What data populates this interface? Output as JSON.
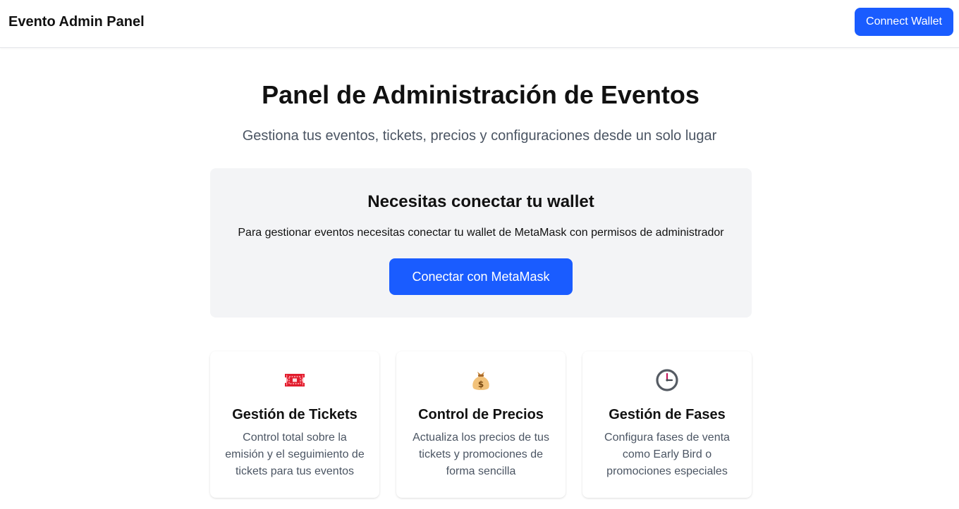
{
  "header": {
    "brand": "Evento Admin Panel",
    "connect_label": "Connect Wallet"
  },
  "hero": {
    "title": "Panel de Administración de Eventos",
    "subtitle": "Gestiona tus eventos, tickets, precios y configuraciones desde un solo lugar"
  },
  "wallet": {
    "title": "Necesitas conectar tu wallet",
    "description": "Para gestionar eventos necesitas conectar tu wallet de MetaMask con permisos de administrador",
    "button_label": "Conectar con MetaMask"
  },
  "features": [
    {
      "icon": "ticket-icon",
      "title": "Gestión de Tickets",
      "description": "Control total sobre la emisión y el seguimiento de tickets para tus eventos"
    },
    {
      "icon": "money-bag-icon",
      "title": "Control de Precios",
      "description": "Actualiza los precios de tus tickets y promociones de forma sencilla"
    },
    {
      "icon": "clock-icon",
      "title": "Gestión de Fases",
      "description": "Configura fases de venta como Early Bird o promociones especiales"
    }
  ],
  "colors": {
    "primary": "#1a5cff",
    "panel_bg": "#f3f4f6",
    "muted_text": "#4b5563"
  }
}
